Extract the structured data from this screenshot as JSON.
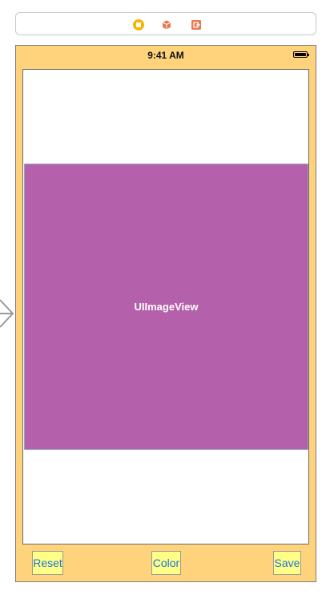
{
  "scene_dock": {
    "icons": [
      "view-controller-icon",
      "first-responder-icon",
      "exit-icon"
    ],
    "colors": {
      "view_controller": "#f7b500",
      "first_responder": "#e8784d",
      "exit": "#e8784d"
    }
  },
  "status_bar": {
    "time": "9:41 AM",
    "battery": "battery-icon"
  },
  "image_view": {
    "label": "UIImageView",
    "background": "#b560ab"
  },
  "toolbar": {
    "reset_label": "Reset",
    "color_label": "Color",
    "save_label": "Save"
  },
  "colors": {
    "scene_background": "#ffd27c",
    "button_background": "#ffff88",
    "button_text": "#1e73d8"
  }
}
